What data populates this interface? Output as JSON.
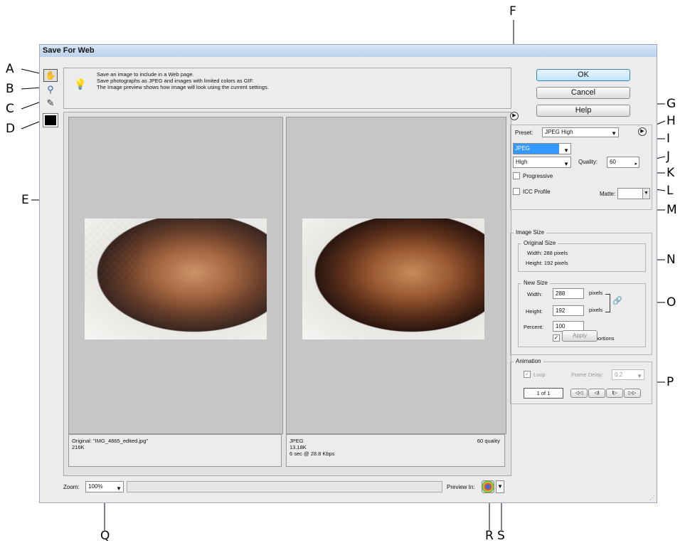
{
  "window": {
    "title": "Save For Web"
  },
  "tips": {
    "lines": [
      "Save an image to include in a Web page.",
      "Save photographs as JPEG and images with limited colors as GIF.",
      "The Image preview shows how image will look using the current settings."
    ]
  },
  "tools": [
    "hand-tool",
    "zoom-tool",
    "eyedropper-tool",
    "eyedropper-color-swatch"
  ],
  "buttons": {
    "ok": "OK",
    "cancel": "Cancel",
    "help": "Help",
    "apply": "Apply"
  },
  "settings": {
    "preset_label": "Preset:",
    "preset_value": "JPEG High",
    "format_value": "JPEG",
    "quality_level": "High",
    "quality_label": "Quality:",
    "quality_value": "60",
    "progressive_label": "Progressive",
    "icc_label": "ICC Profile",
    "matte_label": "Matte:"
  },
  "image_size": {
    "title": "Image Size",
    "original_title": "Original Size",
    "orig_width": "Width: 288 pixels",
    "orig_height": "Height: 192 pixels",
    "new_title": "New Size",
    "width_label": "Width:",
    "width_value": "288",
    "height_label": "Height:",
    "height_value": "192",
    "pixels": "pixels",
    "percent_label": "Percent:",
    "percent_value": "100",
    "constrain_label": "Constrain Proportions"
  },
  "animation": {
    "title": "Animation",
    "loop_label": "Loop",
    "frame_delay_label": "Frame Delay:",
    "frame_delay_value": "0.2",
    "frame_counter": "1 of 1",
    "nav": [
      "◁◁",
      "◁I",
      "I▷",
      "▷▷"
    ]
  },
  "original_pane": {
    "line1": "Original: \"IMG_4865_edited.jpg\"",
    "line2": "216K"
  },
  "optimized_pane": {
    "format": "JPEG",
    "size": "13.18K",
    "time": "6 sec @ 28.8 Kbps",
    "quality": "60 quality"
  },
  "bottom": {
    "zoom_label": "Zoom:",
    "zoom_value": "100%",
    "preview_label": "Preview In:"
  },
  "callouts": [
    "A",
    "B",
    "C",
    "D",
    "E",
    "F",
    "G",
    "H",
    "I",
    "J",
    "K",
    "L",
    "M",
    "N",
    "O",
    "P",
    "Q",
    "R",
    "S"
  ]
}
